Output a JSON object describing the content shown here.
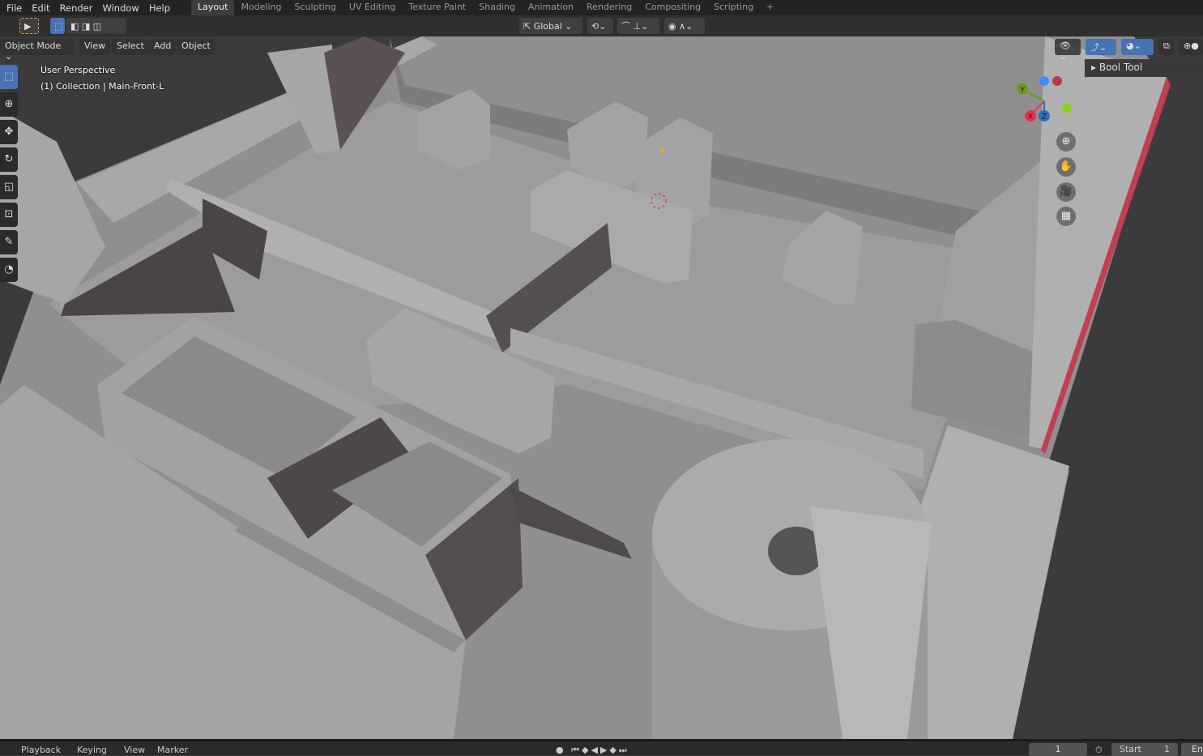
{
  "menu": [
    "File",
    "Edit",
    "Render",
    "Window",
    "Help"
  ],
  "workspaces": [
    "Layout",
    "Modeling",
    "Sculpting",
    "UV Editing",
    "Texture Paint",
    "Shading",
    "Animation",
    "Rendering",
    "Compositing",
    "Scripting",
    "+"
  ],
  "active_workspace": "Layout",
  "toolbar": {
    "orientation": "Global"
  },
  "viewport_header": {
    "mode": "Object Mode",
    "menus": [
      "View",
      "Select",
      "Add",
      "Object"
    ]
  },
  "overlay": {
    "perspective": "User Perspective",
    "collection": "(1) Collection | Main-Front-L"
  },
  "sidebar_panel": {
    "title": "Bool Tool"
  },
  "gizmo": {
    "axes": [
      "X",
      "Y",
      "Z"
    ],
    "colors": {
      "x": "#e8344f",
      "y": "#6a9a22",
      "z": "#2f6ec2"
    }
  },
  "navigation": [
    "zoom-icon",
    "hand-pan-icon",
    "camera-icon",
    "grid-ortho-icon"
  ],
  "timeline": {
    "menus": [
      "Playback",
      "Keying",
      "View",
      "Marker"
    ],
    "current_frame": "1",
    "start_label": "Start",
    "start_value": "1",
    "end_label": "En"
  },
  "colors": {
    "accent": "#4772b3",
    "background": "#3a3a3a",
    "header": "#232323"
  }
}
